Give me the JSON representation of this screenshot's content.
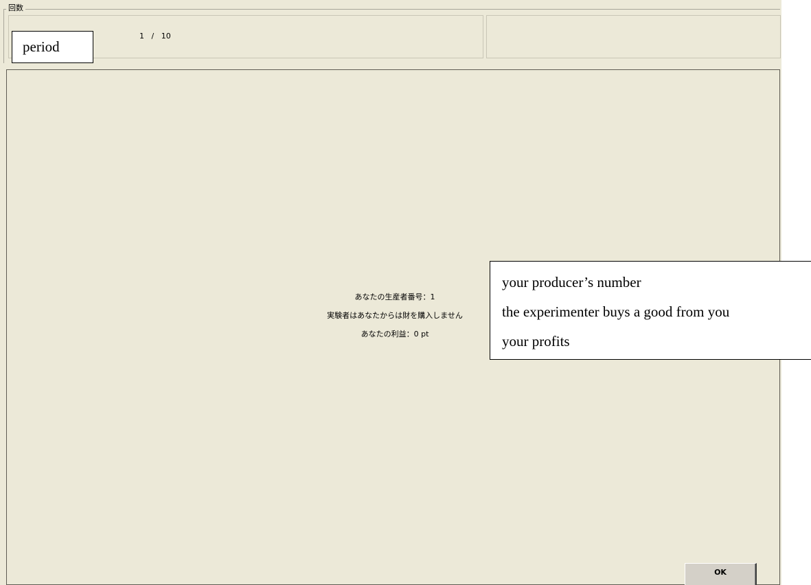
{
  "groupbox": {
    "title": "回数"
  },
  "period": {
    "current": "1",
    "separator": "/",
    "total": "10"
  },
  "annotations": {
    "period": "period",
    "info_rows": [
      "your producer’s number",
      "the experimenter buys a good from you",
      "your profits"
    ]
  },
  "info": {
    "producer_number": "あなたの生産者番号：1",
    "purchase_status": "実験者はあなたからは財を購入しません",
    "profit": "あなたの利益：0 pt"
  },
  "buttons": {
    "ok_label": "OK"
  },
  "colors": {
    "window_bg": "#ece9d8",
    "frame_border": "#5d5b52",
    "button_face": "#d4d0c8"
  }
}
